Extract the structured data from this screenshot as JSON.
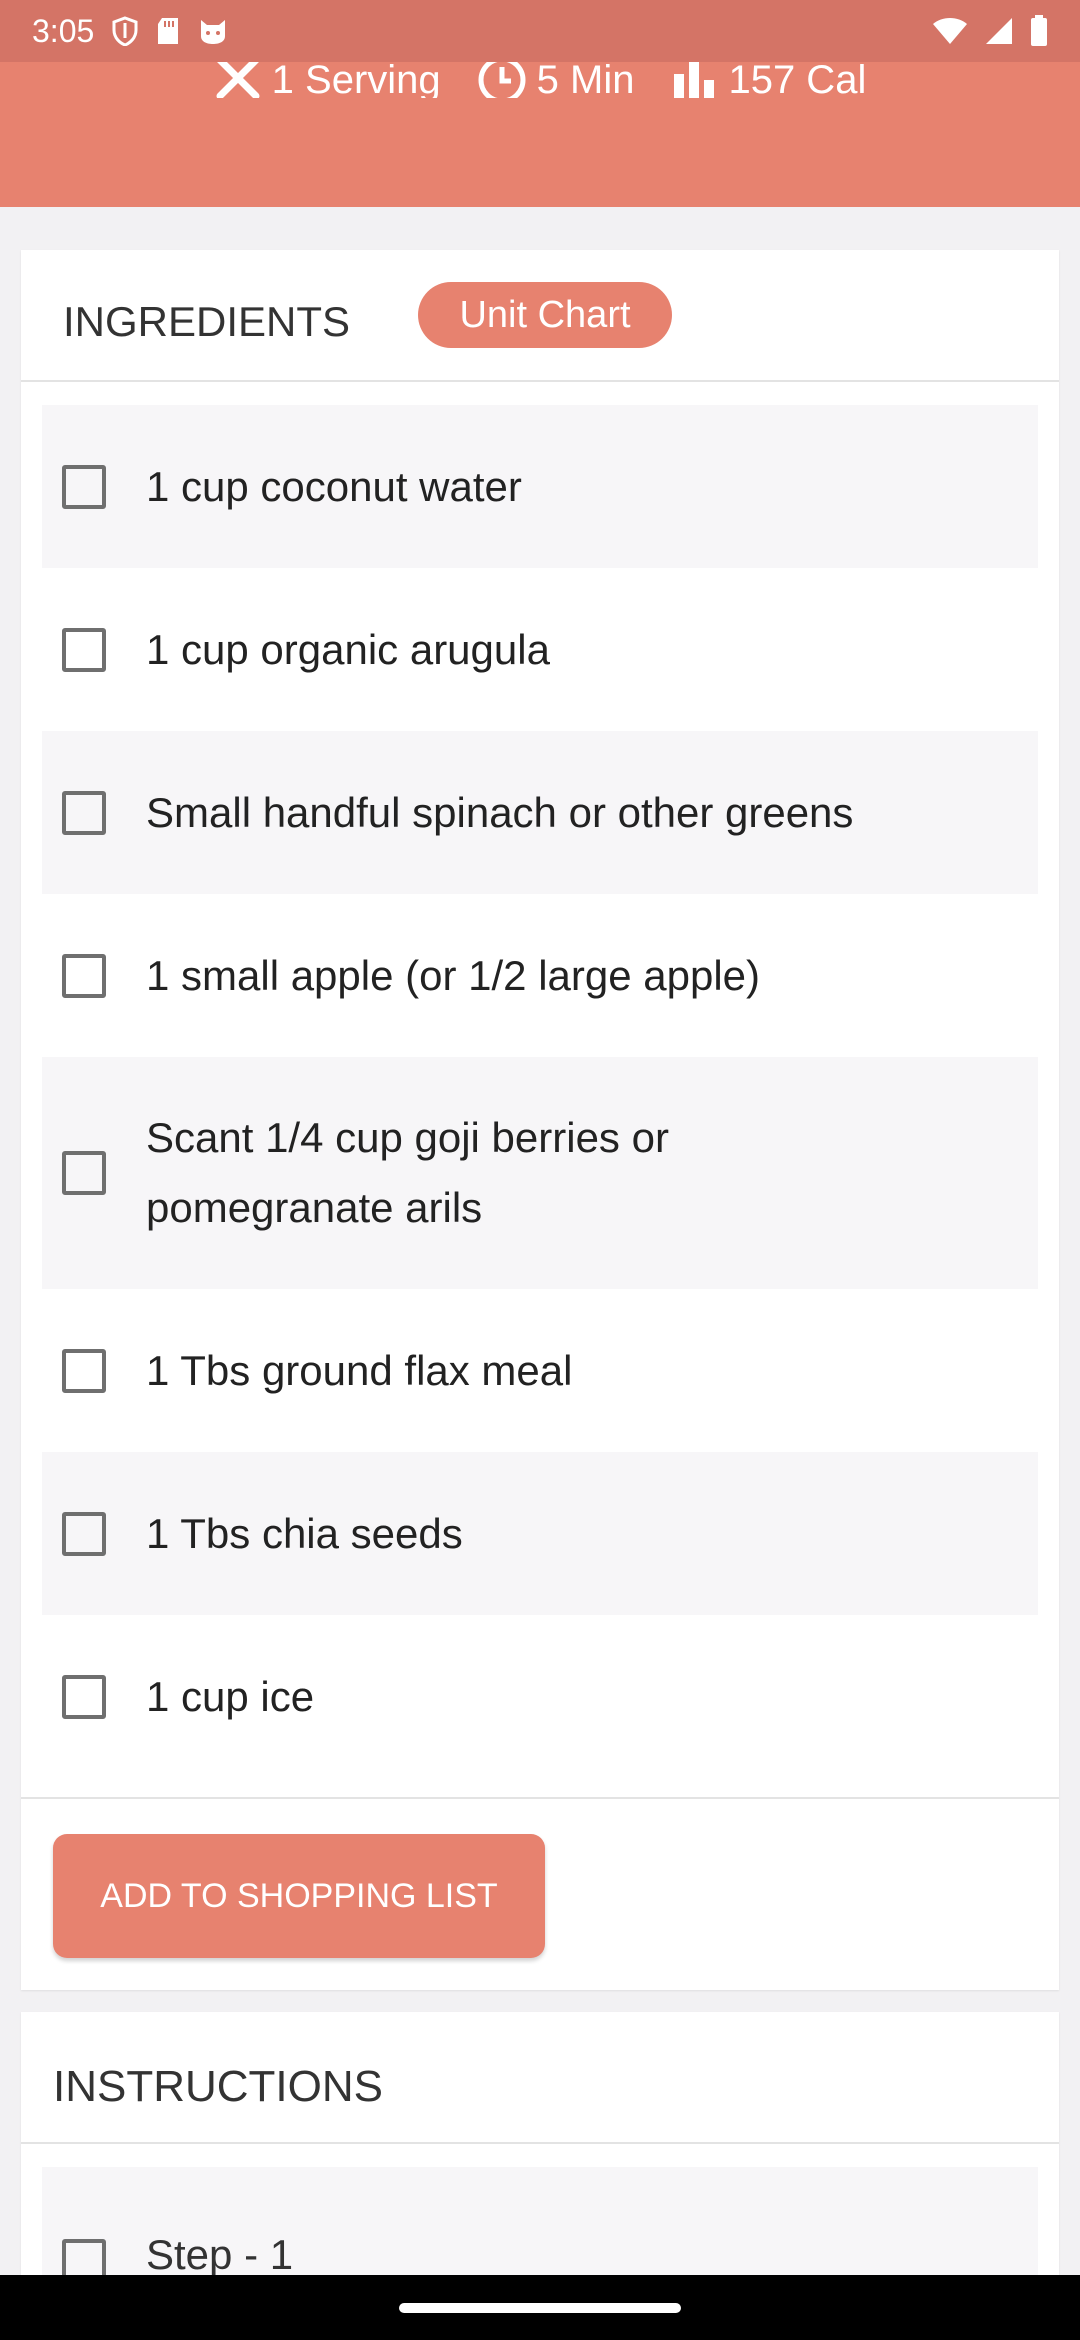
{
  "status_bar": {
    "time": "3:05",
    "left_icons": [
      "shield-icon",
      "sd-card-icon",
      "cat-face-icon"
    ],
    "right_icons": [
      "wifi-icon",
      "signal-icon",
      "battery-icon"
    ]
  },
  "header": {
    "meta": [
      {
        "icon": "fork-knife-icon",
        "text": "1 Serving"
      },
      {
        "icon": "clock-icon",
        "text": "5 Min"
      },
      {
        "icon": "bar-chart-icon",
        "text": "157 Cal"
      }
    ]
  },
  "ingredients": {
    "title": "INGREDIENTS",
    "unit_chart_label": "Unit Chart",
    "items": [
      "1 cup coconut water",
      "1 cup organic arugula",
      "Small handful spinach or other greens",
      "1 small apple (or 1/2 large apple)",
      "Scant 1/4 cup goji berries or pomegranate arils",
      "1 Tbs ground flax meal",
      "1 Tbs chia seeds",
      "1 cup ice"
    ],
    "add_button_label": "ADD TO SHOPPING LIST"
  },
  "instructions": {
    "title": "INSTRUCTIONS",
    "steps": [
      "Step - 1"
    ]
  },
  "colors": {
    "accent": "#e7826f",
    "status_bar": "#d47466",
    "row_alt": "#f7f6f8"
  }
}
